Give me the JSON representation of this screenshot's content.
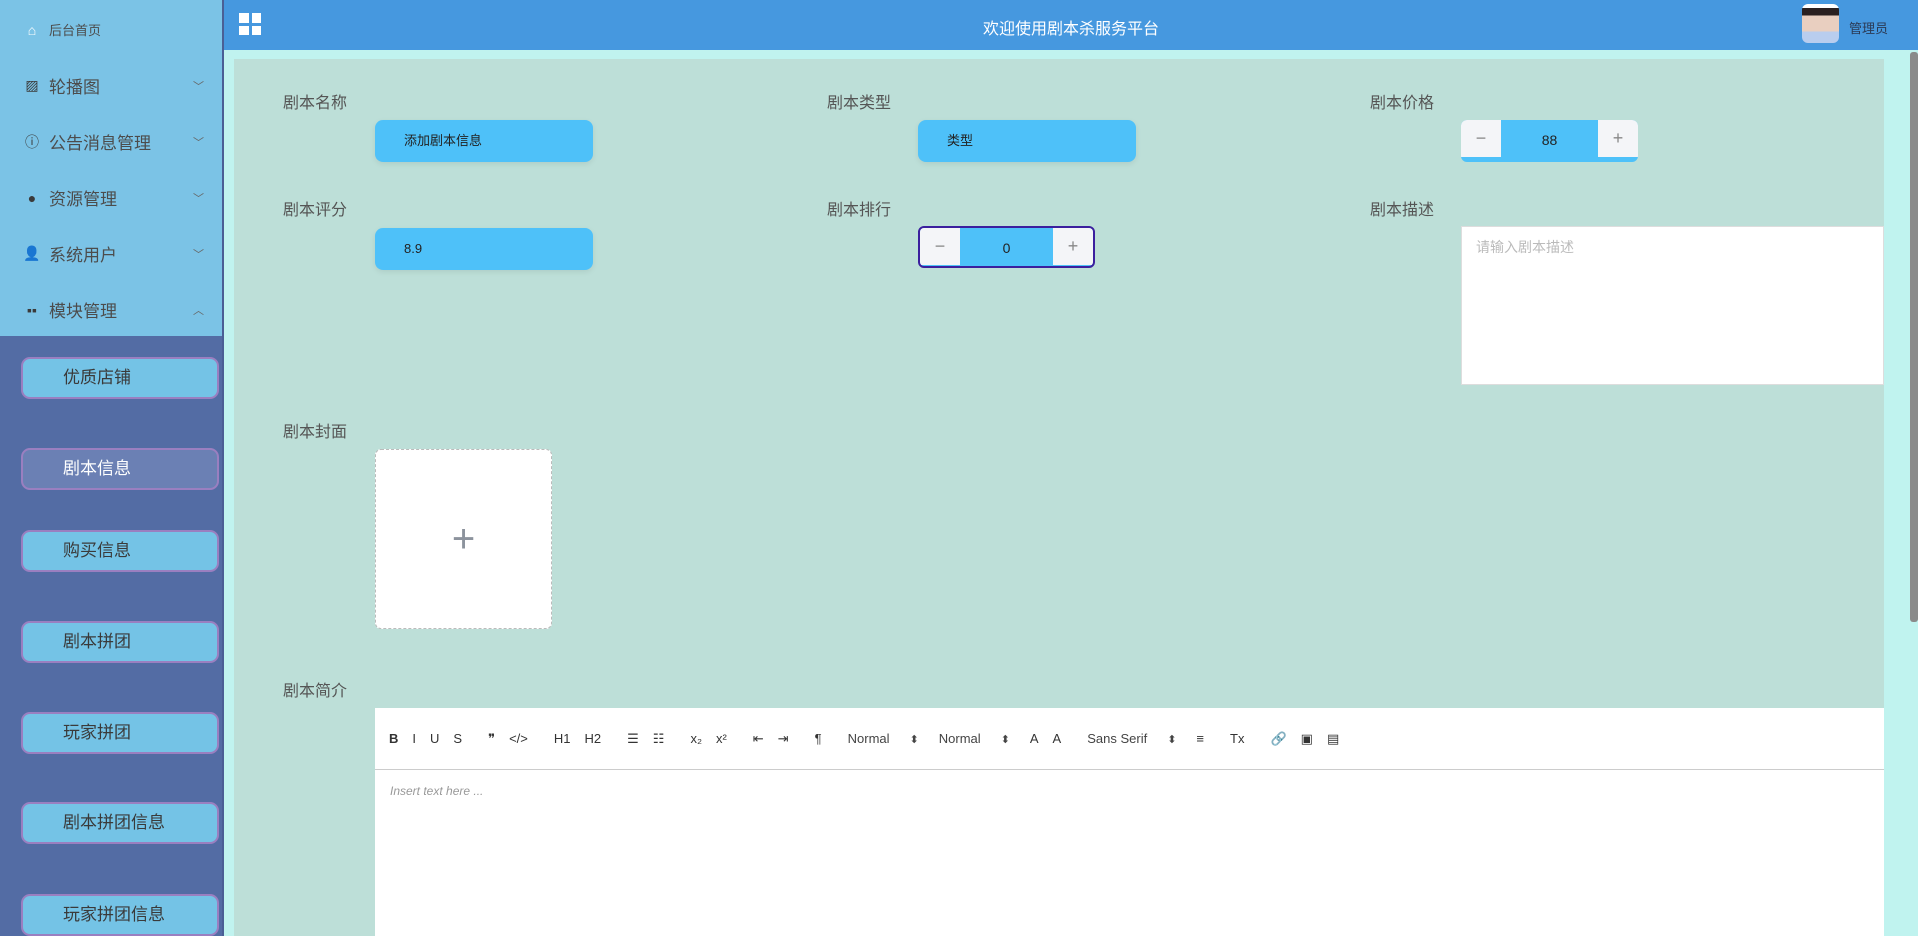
{
  "header": {
    "title": "欢迎使用剧本杀服务平台",
    "user": "管理员"
  },
  "sidebar": {
    "items": [
      {
        "label": "后台首页",
        "icon": "home-icon"
      },
      {
        "label": "轮播图",
        "icon": "picture-icon"
      },
      {
        "label": "公告消息管理",
        "icon": "info-icon"
      },
      {
        "label": "资源管理",
        "icon": "bulb-icon"
      },
      {
        "label": "系统用户",
        "icon": "user-icon"
      },
      {
        "label": "模块管理",
        "icon": "grid-icon"
      }
    ],
    "submenu": [
      "优质店铺",
      "剧本信息",
      "购买信息",
      "剧本拼团",
      "玩家拼团",
      "剧本拼团信息",
      "玩家拼团信息"
    ],
    "active": "剧本信息"
  },
  "form": {
    "name": {
      "label": "剧本名称",
      "value": "添加剧本信息"
    },
    "type": {
      "label": "剧本类型",
      "value": "类型"
    },
    "price": {
      "label": "剧本价格",
      "value": "88",
      "minus": "−",
      "plus": "+"
    },
    "score": {
      "label": "剧本评分",
      "value": "8.9"
    },
    "rank": {
      "label": "剧本排行",
      "value": "0",
      "minus": "−",
      "plus": "+"
    },
    "desc": {
      "label": "剧本描述",
      "placeholder": "请输入剧本描述"
    },
    "cover": {
      "label": "剧本封面",
      "plus": "+"
    },
    "intro": {
      "label": "剧本简介",
      "placeholder": "Insert text here ..."
    }
  },
  "toolbar": [
    {
      "t": "B",
      "n": "bold-button",
      "c": "b"
    },
    {
      "t": "I",
      "n": "italic-button"
    },
    {
      "t": "U",
      "n": "underline-button"
    },
    {
      "t": "S",
      "n": "strike-button"
    },
    {
      "t": "❞",
      "n": "blockquote-button",
      "c": "gap"
    },
    {
      "t": "</>",
      "n": "code-block-button"
    },
    {
      "t": "H1",
      "n": "header1-button",
      "c": "gap"
    },
    {
      "t": "H2",
      "n": "header2-button"
    },
    {
      "t": "☰",
      "n": "ordered-list-button",
      "c": "gap"
    },
    {
      "t": "☷",
      "n": "bullet-list-button"
    },
    {
      "t": "x₂",
      "n": "subscript-button",
      "c": "gap"
    },
    {
      "t": "x²",
      "n": "superscript-button"
    },
    {
      "t": "⇤",
      "n": "outdent-button",
      "c": "gap"
    },
    {
      "t": "⇥",
      "n": "indent-button"
    },
    {
      "t": "¶",
      "n": "direction-button",
      "c": "gap"
    },
    {
      "t": "Normal",
      "n": "size-select",
      "c": "sel gap"
    },
    {
      "t": "Normal",
      "n": "header-select",
      "c": "sel"
    },
    {
      "t": "A",
      "n": "color-button"
    },
    {
      "t": "A",
      "n": "background-button"
    },
    {
      "t": "Sans Serif",
      "n": "font-select",
      "c": "sel gap"
    },
    {
      "t": "≡",
      "n": "align-button"
    },
    {
      "t": "Tx",
      "n": "clean-button",
      "c": "gap"
    },
    {
      "t": "🔗",
      "n": "link-button",
      "c": "gap"
    },
    {
      "t": "▣",
      "n": "image-button"
    },
    {
      "t": "▤",
      "n": "video-button"
    }
  ]
}
